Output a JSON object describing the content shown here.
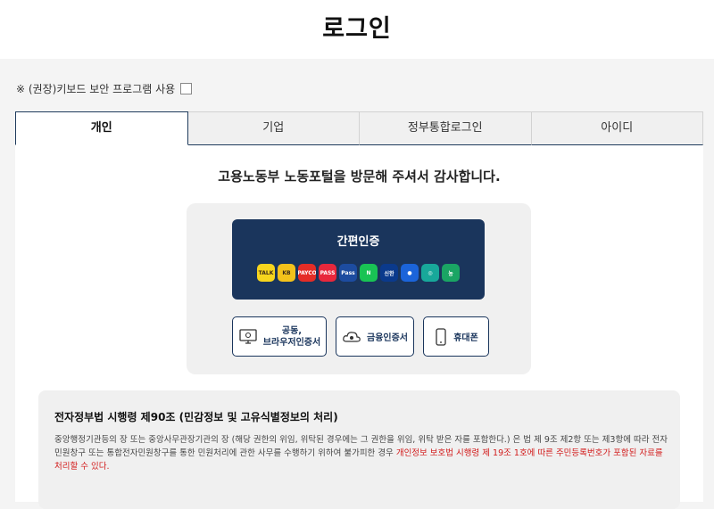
{
  "header": {
    "title": "로그인"
  },
  "keyboard_security": {
    "label": "※ (권장)키보드 보안 프로그램 사용",
    "checked": false
  },
  "tabs": [
    {
      "label": "개인",
      "active": true
    },
    {
      "label": "기업",
      "active": false
    },
    {
      "label": "정부통합로그인",
      "active": false
    },
    {
      "label": "아이디",
      "active": false
    }
  ],
  "welcome": "고용노동부 노동포털을 방문해 주셔서 감사합니다.",
  "simple_auth": {
    "label": "간편인증",
    "providers": [
      {
        "name": "kakao",
        "text": "TALK",
        "color": "#f7d51d",
        "fg": "#3b2a1a"
      },
      {
        "name": "kb",
        "text": "KB",
        "color": "#f4c21b",
        "fg": "#3b2a1a"
      },
      {
        "name": "payco",
        "text": "PAYCO",
        "color": "#e52d27",
        "fg": "#ffffff"
      },
      {
        "name": "pass",
        "text": "PASS",
        "color": "#e8283c",
        "fg": "#ffffff"
      },
      {
        "name": "samsung-pass",
        "text": "Pass",
        "color": "#1d4ca0",
        "fg": "#ffffff"
      },
      {
        "name": "naver",
        "text": "N",
        "color": "#19c354",
        "fg": "#ffffff"
      },
      {
        "name": "shinhan",
        "text": "신한",
        "color": "#0b3a8c",
        "fg": "#ffffff"
      },
      {
        "name": "toss",
        "text": "●",
        "color": "#1b64da",
        "fg": "#ffffff"
      },
      {
        "name": "hana",
        "text": "◎",
        "color": "#18a89a",
        "fg": "#ffffff"
      },
      {
        "name": "nh",
        "text": "농",
        "color": "#1aa564",
        "fg": "#ffffff"
      }
    ]
  },
  "cert_buttons": {
    "joint": "공동,\n브라우저인증서",
    "financial": "금융인증서",
    "mobile": "휴대폰"
  },
  "notice": {
    "title": "전자정부법 시행령 제90조 (민감정보 및 고유식별정보의 처리)",
    "body_normal": "중앙행정기관등의 장 또는 중앙사무관장기관의 장 (해당 권한의 위임, 위탁된 경우에는 그 권한을 위임, 위탁 받은 자를 포함한다.) 은 법 제 9조 제2항 또는 제3항에 따라 전자민원창구 또는 통합전자민원창구를 통한 민원처리에 관한 사무를 수행하기 위하여 불가피한 경우 ",
    "body_red": "개인정보 보호법 시행령 제 19조 1호에 따른 주민등록번호가 포함된 자료를 처리할 수 있다."
  },
  "colors": {
    "navy": "#1a355c",
    "accent_red": "#d21a1a"
  }
}
